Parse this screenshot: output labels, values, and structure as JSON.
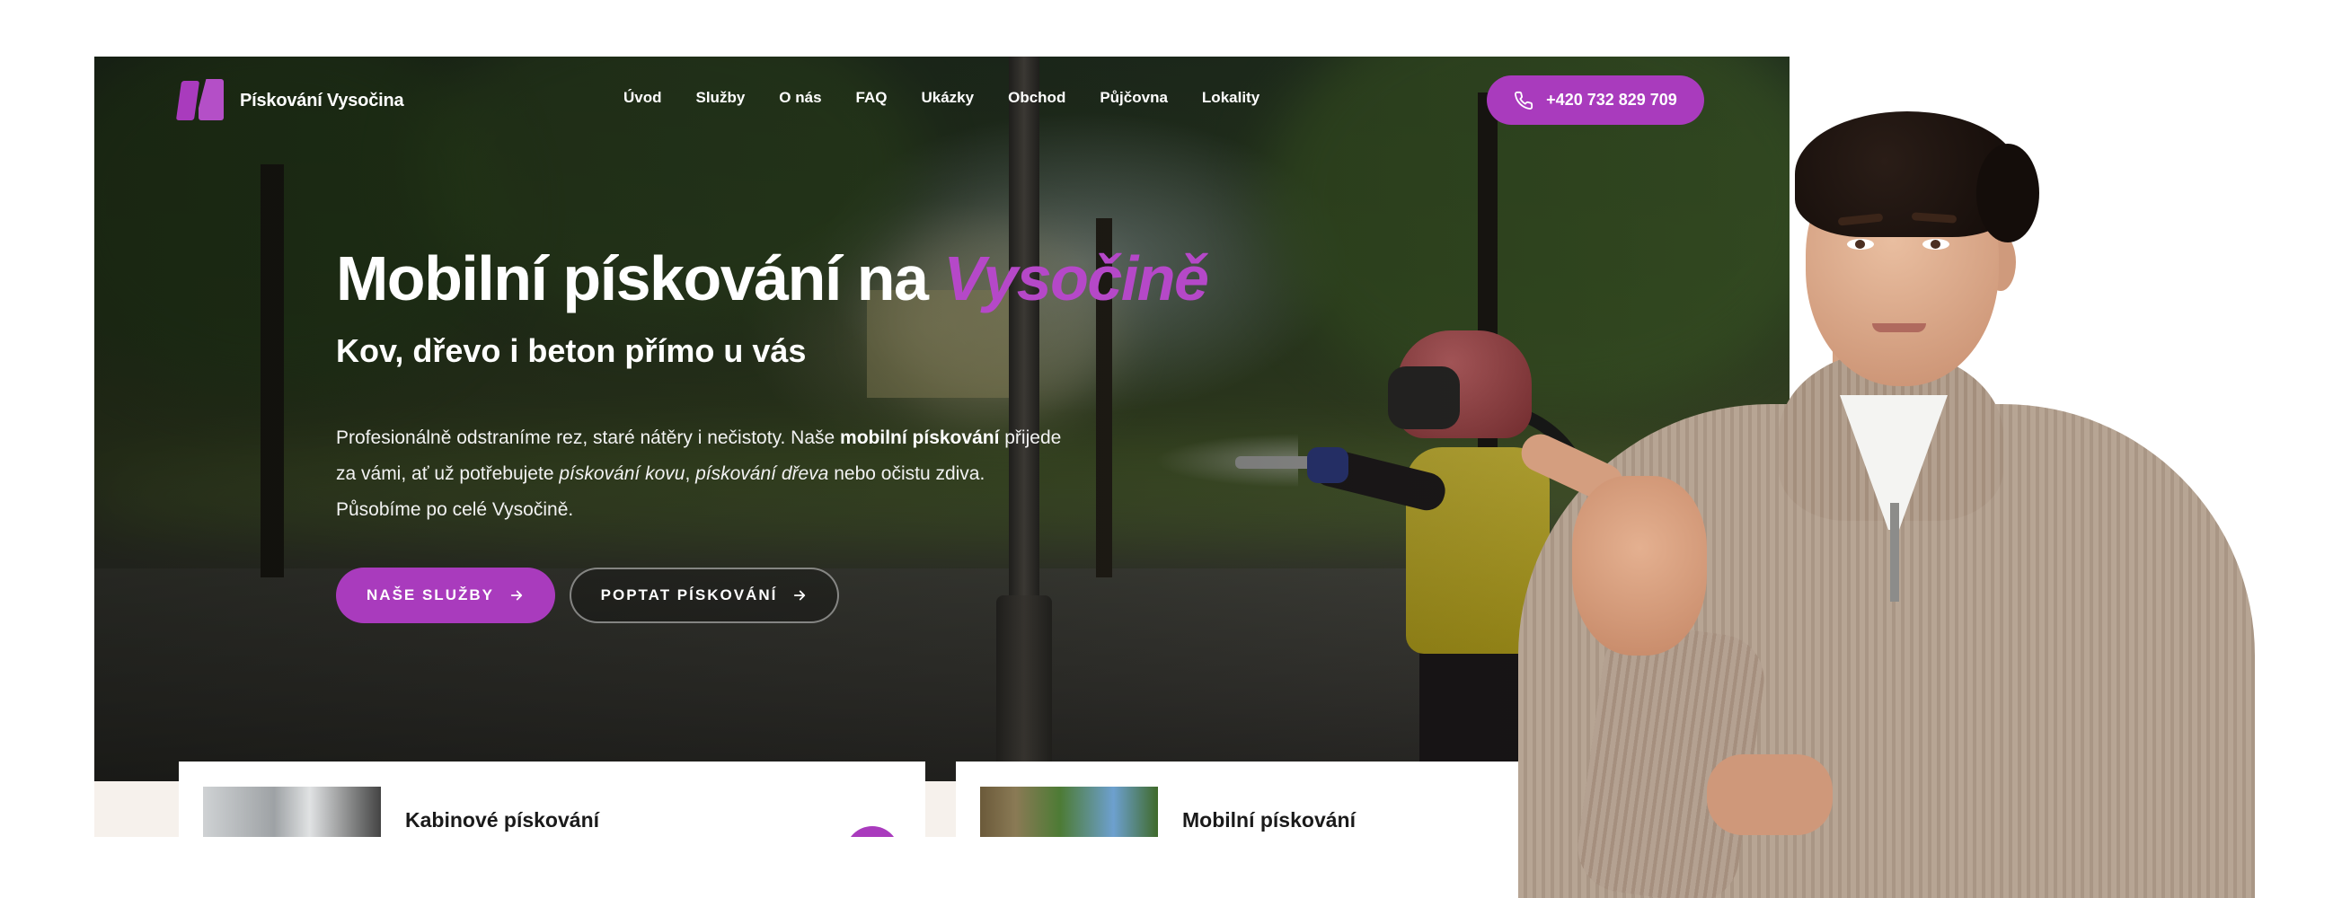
{
  "brand": {
    "name": "Pískování Vysočina",
    "accent_color": "#a93bbd"
  },
  "nav": {
    "items": [
      "Úvod",
      "Služby",
      "O nás",
      "FAQ",
      "Ukázky",
      "Obchod",
      "Půjčovna",
      "Lokality"
    ],
    "phone": "+420 732 829 709",
    "phone_icon": "phone-icon"
  },
  "hero": {
    "title_main": "Mobilní pískování na ",
    "title_accent": "Vysočině",
    "subtitle": "Kov, dřevo i beton přímo u vás",
    "para_1": "Profesionálně odstraníme rez, staré nátěry i nečistoty. Naše ",
    "para_bold": "mobilní pískování",
    "para_2": " přijede za vámi, ať už potřebujete ",
    "para_link1": "pískování kovu",
    "para_sep": ", ",
    "para_link2": "pískování dřeva",
    "para_3": " nebo očistu zdiva. Působíme po celé Vysočině.",
    "btn_primary": "NAŠE SLUŽBY",
    "btn_secondary": "POPTAT PÍSKOVÁNÍ"
  },
  "cards": [
    {
      "title": "Kabinové pískování"
    },
    {
      "title": "Mobilní pískování"
    }
  ]
}
